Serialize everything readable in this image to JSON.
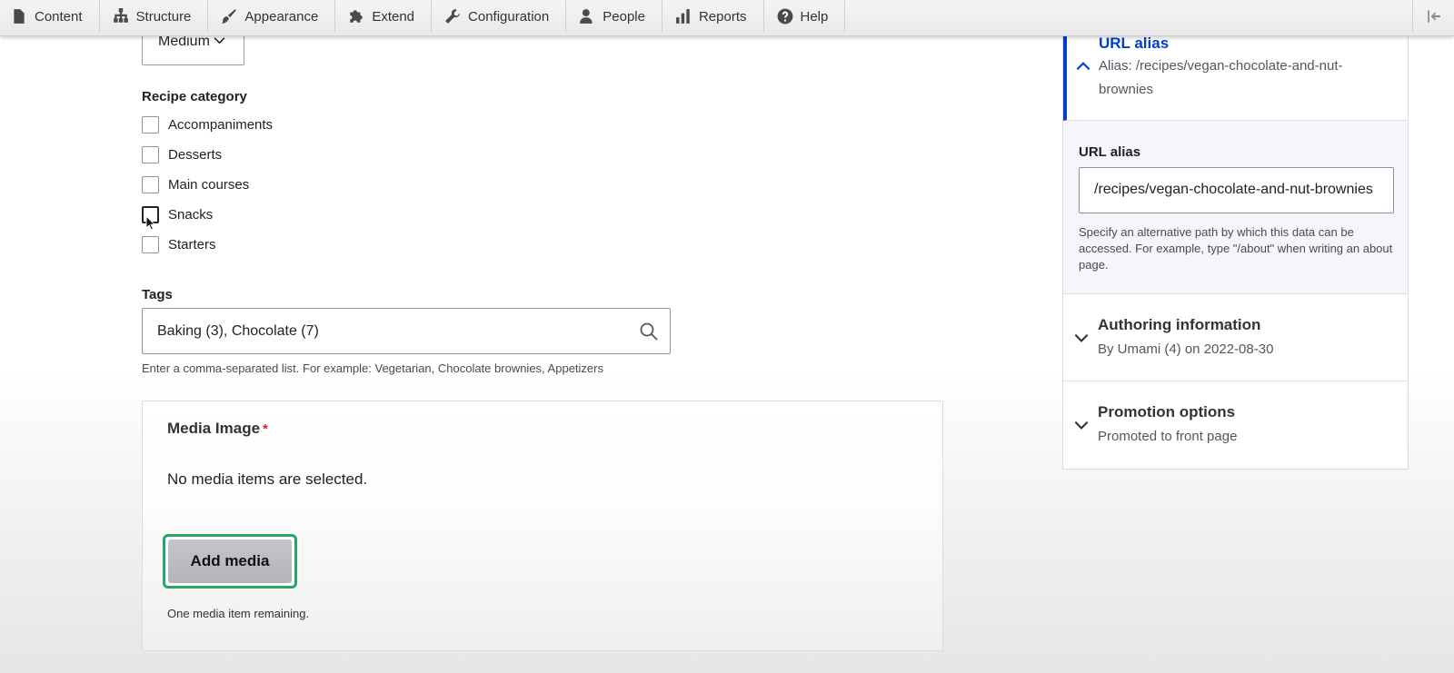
{
  "toolbar": {
    "items": [
      {
        "label": "Content",
        "icon": "file-icon"
      },
      {
        "label": "Structure",
        "icon": "sitemap-icon"
      },
      {
        "label": "Appearance",
        "icon": "paintbrush-icon"
      },
      {
        "label": "Extend",
        "icon": "puzzle-icon"
      },
      {
        "label": "Configuration",
        "icon": "wrench-icon"
      },
      {
        "label": "People",
        "icon": "person-icon"
      },
      {
        "label": "Reports",
        "icon": "bar-chart-icon"
      },
      {
        "label": "Help",
        "icon": "question-icon"
      }
    ]
  },
  "form": {
    "difficulty_value": "Medium",
    "recipe_category": {
      "label": "Recipe category",
      "options": [
        "Accompaniments",
        "Desserts",
        "Main courses",
        "Snacks",
        "Starters"
      ]
    },
    "tags": {
      "label": "Tags",
      "value": "Baking (3), Chocolate (7)",
      "help": "Enter a comma-separated list. For example: Vegetarian, Chocolate brownies, Appetizers"
    },
    "media": {
      "label": "Media Image",
      "required_marker": "*",
      "empty_text": "No media items are selected.",
      "button_label": "Add media",
      "remaining_text": "One media item remaining."
    }
  },
  "sidebar": {
    "url_alias": {
      "title": "URL alias",
      "summary": "Alias: /recipes/vegan-chocolate-and-nut-brownies",
      "field_label": "URL alias",
      "field_value": "/recipes/vegan-chocolate-and-nut-brownies",
      "help": "Specify an alternative path by which this data can be accessed. For example, type \"/about\" when writing an about page."
    },
    "authoring": {
      "title": "Authoring information",
      "summary": "By Umami (4) on 2022-08-30"
    },
    "promotion": {
      "title": "Promotion options",
      "summary": "Promoted to front page"
    }
  },
  "colors": {
    "link_blue": "#003ecc",
    "focus_green": "#26a769",
    "required_red": "#dc2323"
  }
}
